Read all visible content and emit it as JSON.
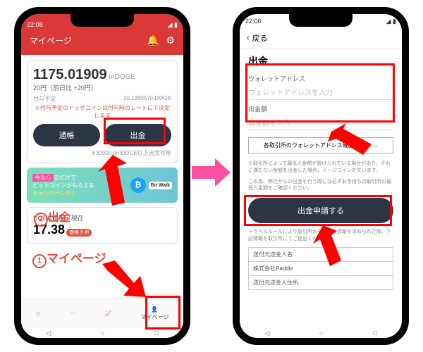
{
  "left": {
    "time": "22:08",
    "page_title": "マイページ",
    "balance": "1175.01909",
    "unit": "mDOGE",
    "yen": "20円（前日比 +20円）",
    "grant_label": "付与予定",
    "grant_value": "20.138057mDOGE",
    "rate_warn": "※付与予定のドッグコインは付与時のレートにて決定します",
    "btn_passbook": "通帳",
    "btn_withdraw": "出金",
    "limit_note": "※30000.0mDOGE以上出金可能",
    "banner_lead": "今なら",
    "banner_suffix": "るだけで",
    "banner_l2": "ビットコインがもらえる",
    "banner_l3": "キャンペーン中！",
    "bitwalk": "Bit Walk",
    "price_label": "DOGE価格（現在",
    "price": "17.38",
    "price_badge": "価格予測",
    "nav_mypage": "マイページ",
    "ov_withdraw": "出金",
    "ov_mypage": "マイページ"
  },
  "right": {
    "time": "22:06",
    "back": "戻る",
    "title": "出金",
    "addr_label": "ウォレットアドレス",
    "addr_ph": "ウォレットアドレスを入力",
    "amt_label": "出金額",
    "amt_ph": "出金額を入力",
    "link": "各取引所のウォレットアドレス確認方法は →",
    "note1": "※取引所によって最低入金額が設けられている場合があり、それに満たない金額を出金した場合、ドージコインを失います。",
    "note2": "この為、弊社からの出金を行う際には必ずお手持ちの取引所の最低入金額をご確認ください。",
    "submit": "出金申請する",
    "travel": "トラベルルールにより取引所から送金元情報を求められた際、下記情報を取引所にてご提出ください。",
    "t1": "送付元送金人名",
    "t2": "株式会社Paddle",
    "t3": "送付元送金人住所"
  }
}
